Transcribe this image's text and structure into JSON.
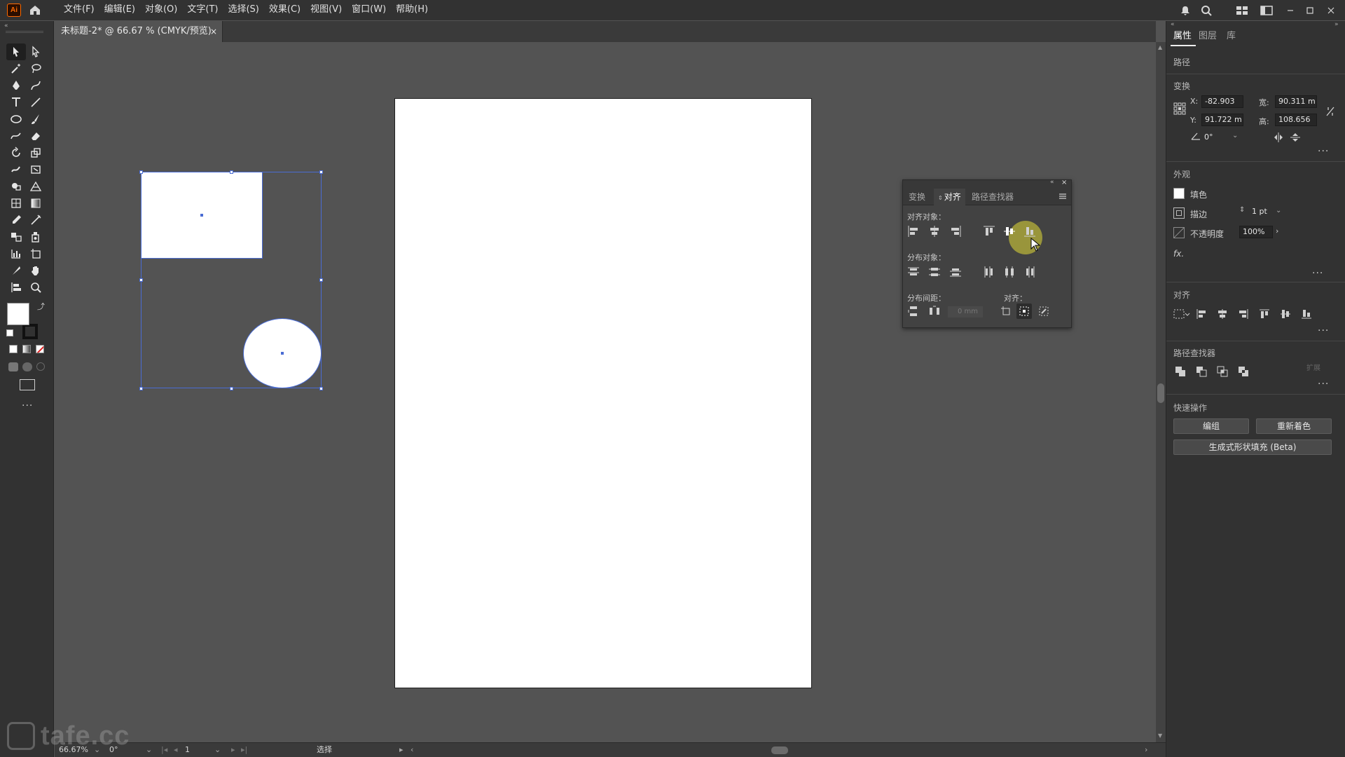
{
  "app": {
    "logo_text": "Ai",
    "brand_color": "#ff6a00",
    "menu": [
      "文件(F)",
      "编辑(E)",
      "对象(O)",
      "文字(T)",
      "选择(S)",
      "效果(C)",
      "视图(V)",
      "窗口(W)",
      "帮助(H)"
    ]
  },
  "document_tab": {
    "title": "未标题-2* @ 66.67 % (CMYK/预览)",
    "close": "×"
  },
  "status_bar": {
    "zoom": "66.67%",
    "rotation": "0°",
    "artboard_number": "1",
    "tool_status": "选择"
  },
  "watermark": {
    "text": "tafe.cc"
  },
  "properties_panel": {
    "tabs": [
      "属性",
      "图层",
      "库"
    ],
    "active_tab": "属性",
    "object_type": "路径",
    "transform": {
      "heading": "变换",
      "x_label": "X:",
      "x_value": "-82.903",
      "y_label": "Y:",
      "y_value": "91.722 m",
      "w_label": "宽:",
      "w_value": "90.311 m",
      "h_label": "高:",
      "h_value": "108.656",
      "angle_value": "0°"
    },
    "appearance": {
      "heading": "外观",
      "fill_label": "填色",
      "stroke_label": "描边",
      "stroke_value": "1 pt",
      "opacity_label": "不透明度",
      "opacity_value": "100%",
      "fx_label": "fx."
    },
    "align": {
      "heading": "对齐"
    },
    "pathfinder": {
      "heading": "路径查找器",
      "expand_label": "扩展"
    },
    "quick_actions": {
      "heading": "快速操作",
      "group_button": "编组",
      "recolor_button": "重新着色",
      "generative_button": "生成式形状填充 (Beta)"
    }
  },
  "align_panel": {
    "tabs": [
      "变换",
      "对齐",
      "路径查找器"
    ],
    "active_tab": "对齐",
    "align_objects_label": "对齐对象：",
    "distribute_objects_label": "分布对象：",
    "distribute_spacing_label": "分布间距：",
    "spacing_value": "0 mm",
    "align_to_label": "对齐："
  },
  "colors": {
    "selection": "#4a6cd4",
    "click_highlight": "#e2da36",
    "ui_dark": "#323232",
    "canvas": "#535353"
  }
}
